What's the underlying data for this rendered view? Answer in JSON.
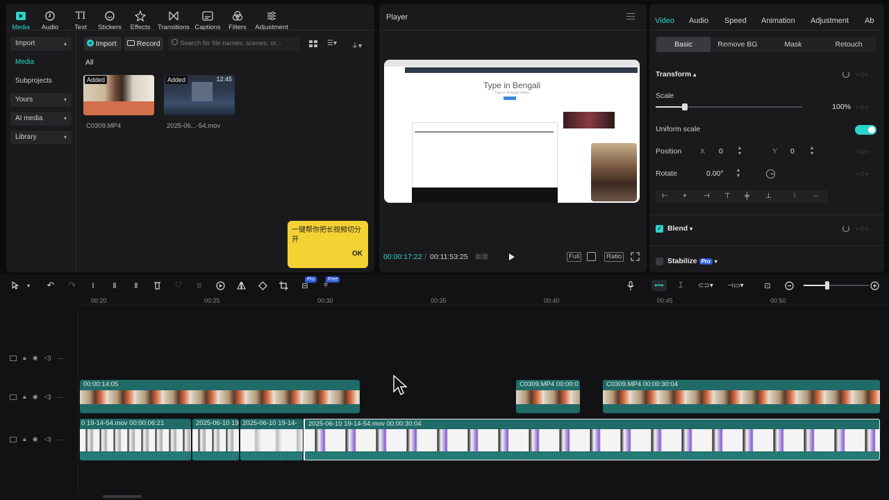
{
  "toolbar": {
    "tabs": [
      {
        "label": "Media",
        "icon": "media-icon"
      },
      {
        "label": "Audio",
        "icon": "audio-icon"
      },
      {
        "label": "Text",
        "icon": "text-icon"
      },
      {
        "label": "Stickers",
        "icon": "stickers-icon"
      },
      {
        "label": "Effects",
        "icon": "effects-icon"
      },
      {
        "label": "Transitions",
        "icon": "transitions-icon"
      },
      {
        "label": "Captions",
        "icon": "captions-icon"
      },
      {
        "label": "Filters",
        "icon": "filters-icon"
      },
      {
        "label": "Adjustment",
        "icon": "adjustment-icon"
      }
    ]
  },
  "media_sidebar": {
    "import": "Import",
    "media": "Media",
    "subprojects": "Subprojects",
    "yours": "Yours",
    "ai_media": "AI media",
    "library": "Library"
  },
  "media_panel": {
    "import_btn": "Import",
    "record_btn": "Record",
    "search_placeholder": "Search for file names, scenes, or...",
    "filter_all": "All",
    "items": [
      {
        "badge": "Added",
        "name": "C0309.MP4",
        "duration": ""
      },
      {
        "badge": "Added",
        "name": "2025-06...-54.mov",
        "duration": "12:45"
      }
    ]
  },
  "tooltip": {
    "text": "一键帮你把长视频切分开",
    "ok": "OK"
  },
  "player": {
    "title": "Player",
    "current_time": "00:00:17:22",
    "total_time": "00:11:53:25",
    "full_btn": "Full",
    "ratio_btn": "Ratio",
    "preview_heading": "Type in Bengali",
    "preview_sub": "Type in Bengali Online"
  },
  "inspector": {
    "tabs": [
      "Video",
      "Audio",
      "Speed",
      "Animation",
      "Adjustment",
      "Ab"
    ],
    "segments": [
      "Basic",
      "Remove BG",
      "Mask",
      "Retouch"
    ],
    "transform_label": "Transform",
    "scale_label": "Scale",
    "scale_value": "100%",
    "scale_fraction": 0.2,
    "uniform_scale_label": "Uniform scale",
    "uniform_scale_on": true,
    "position_label": "Position",
    "pos_x_label": "X",
    "pos_x": "0",
    "pos_y_label": "Y",
    "pos_y": "0",
    "rotate_label": "Rotate",
    "rotate_value": "0.00°",
    "blend_label": "Blend",
    "stabilize_label": "Stabilize",
    "pro_badge": "Pro"
  },
  "timeline": {
    "badges": {
      "pro": "Pro",
      "free": "Free"
    },
    "ruler": [
      "00:20",
      "00:25",
      "00:30",
      "00:35",
      "00:40",
      "00:45",
      "00:50"
    ],
    "clips_track2": [
      {
        "label": "00:00:14:05"
      },
      {
        "label": "C0309.MP4  00:00:0"
      },
      {
        "label": "C0309.MP4  00:00:30:04"
      }
    ],
    "clips_track3": [
      {
        "label": "0 19-14-54.mov  00:00:06:21"
      },
      {
        "label": "2025-06-10 19"
      },
      {
        "label": "2025-06-10 19-14-"
      },
      {
        "label": "2025-06-10 19-14-54.mov  00:00:30:04"
      }
    ],
    "zoom_fraction": 0.36
  },
  "colors": {
    "accent": "#2ad4c8",
    "clip_teal": "#1f6b68",
    "tooltip_yellow": "#f4d234"
  }
}
